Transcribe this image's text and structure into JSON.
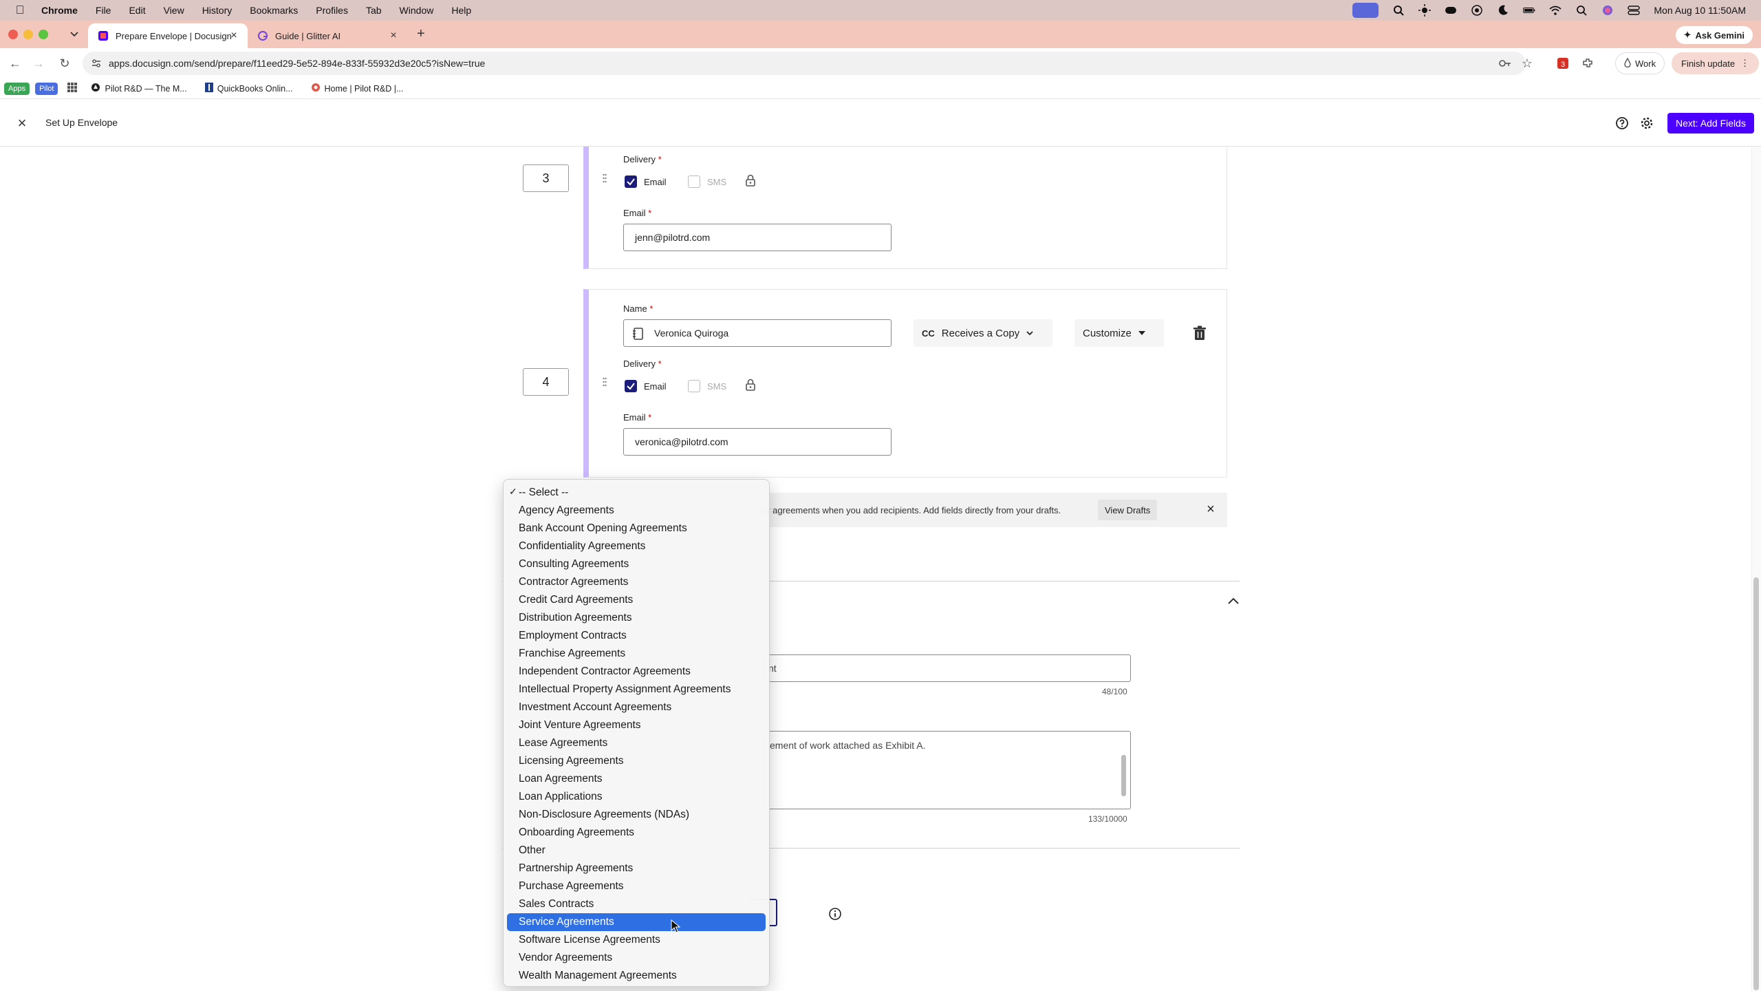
{
  "menubar": {
    "app": "Chrome",
    "items": [
      "File",
      "Edit",
      "View",
      "History",
      "Bookmarks",
      "Profiles",
      "Tab",
      "Window",
      "Help"
    ],
    "clock": "Mon Aug 10  11:50AM"
  },
  "tabs": [
    {
      "title": "Prepare Envelope | Docusign",
      "icon": "docusign-icon",
      "active": true
    },
    {
      "title": "Guide | Glitter AI",
      "icon": "glitter-icon",
      "active": false
    }
  ],
  "ask_gemini": "Ask Gemini",
  "address": {
    "url": "apps.docusign.com/send/prepare/f11eed29-5e52-894e-833f-55932d3e20c5?isNew=true",
    "profile": "Work",
    "update": "Finish update",
    "extension_badge": "3"
  },
  "bookmarks": [
    {
      "label": "Apps",
      "type": "badge",
      "color": "#3aa655"
    },
    {
      "label": "Pilot",
      "type": "badge",
      "color": "#4a6ee0"
    },
    {
      "label": "Pilot R&D — The M...",
      "type": "link"
    },
    {
      "label": "QuickBooks Onlin...",
      "type": "link"
    },
    {
      "label": "Home | Pilot R&D |...",
      "type": "link"
    }
  ],
  "app": {
    "title": "Set Up Envelope",
    "next_button": "Next: Add Fields"
  },
  "recipients": [
    {
      "order": "3",
      "delivery_label": "Delivery",
      "email_option": "Email",
      "sms_option": "SMS",
      "email_label": "Email",
      "email": "jenn@pilotrd.com"
    },
    {
      "order": "4",
      "name_label": "Name",
      "name": "Veronica Quiroga",
      "role_prefix": "CC",
      "role": "Receives a Copy",
      "customize": "Customize",
      "delivery_label": "Delivery",
      "email_option": "Email",
      "sms_option": "SMS",
      "email_label": "Email",
      "email": "veronica@pilotrd.com"
    }
  ],
  "required_mark": "*",
  "info_banner": {
    "text": "ur agreements when you add recipients. Add fields directly from your drafts.",
    "button": "View Drafts"
  },
  "message": {
    "subject_visible": "nt",
    "subject_count": "48/100",
    "body_visible": "ement of work attached as Exhibit A.",
    "body_count": "133/10000"
  },
  "dropdown": {
    "selected_index": 0,
    "highlighted_index": 24,
    "options": [
      "-- Select --",
      "Agency Agreements",
      "Bank Account Opening Agreements",
      "Confidentiality Agreements",
      "Consulting Agreements",
      "Contractor Agreements",
      "Credit Card Agreements",
      "Distribution Agreements",
      "Employment Contracts",
      "Franchise Agreements",
      "Independent Contractor Agreements",
      "Intellectual Property Assignment Agreements",
      "Investment Account Agreements",
      "Joint Venture Agreements",
      "Lease Agreements",
      "Licensing Agreements",
      "Loan Agreements",
      "Loan Applications",
      "Non-Disclosure Agreements (NDAs)",
      "Onboarding Agreements",
      "Other",
      "Partnership Agreements",
      "Purchase Agreements",
      "Sales Contracts",
      "Service Agreements",
      "Software License Agreements",
      "Vendor Agreements",
      "Wealth Management Agreements"
    ]
  },
  "colors": {
    "accent": "#4c00ff",
    "recipient_bar": "#cdb9ff",
    "checkbox": "#1c1c7a",
    "highlight": "#2f6fe4"
  }
}
